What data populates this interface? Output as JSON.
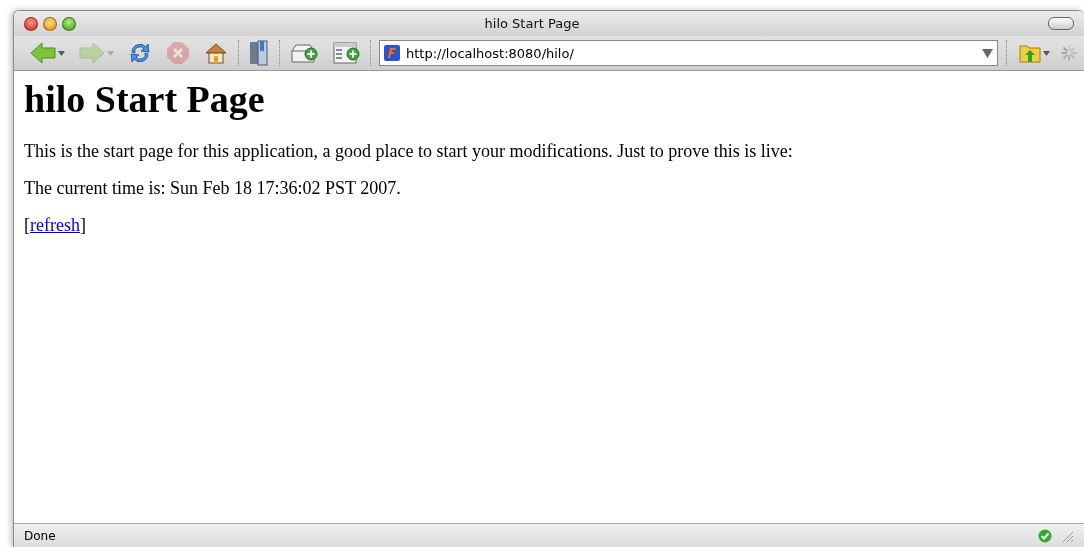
{
  "window": {
    "title": "hilo Start Page"
  },
  "toolbar": {
    "groups": [
      {
        "items": [
          {
            "kind": "back",
            "disabled": false,
            "menu": true
          },
          {
            "kind": "forward",
            "disabled": true,
            "menu": true
          },
          {
            "kind": "reload",
            "disabled": false,
            "menu": false
          },
          {
            "kind": "stop",
            "disabled": true,
            "menu": false
          },
          {
            "kind": "home",
            "disabled": false,
            "menu": false
          }
        ]
      },
      {
        "items": [
          {
            "kind": "bookmarks",
            "disabled": false,
            "menu": false
          }
        ]
      },
      {
        "items": [
          {
            "kind": "newtab",
            "disabled": false,
            "menu": false
          },
          {
            "kind": "newwindow",
            "disabled": false,
            "menu": false
          }
        ]
      }
    ],
    "address": {
      "value": "http://localhost:8080/hilo/"
    },
    "trailing": [
      {
        "kind": "folder",
        "disabled": false,
        "menu": true
      }
    ]
  },
  "page": {
    "heading": "hilo Start Page",
    "paragraphs": [
      {
        "kind": "text",
        "text": "This is the start page for this application, a good place to start your modifications. Just to prove this is live:"
      },
      {
        "kind": "text",
        "text": "The current time is: Sun Feb 18 17:36:02 PST 2007."
      },
      {
        "kind": "link",
        "before": "[",
        "link": "refresh",
        "after": "]"
      }
    ]
  },
  "status_bar": {
    "text": "Done"
  }
}
